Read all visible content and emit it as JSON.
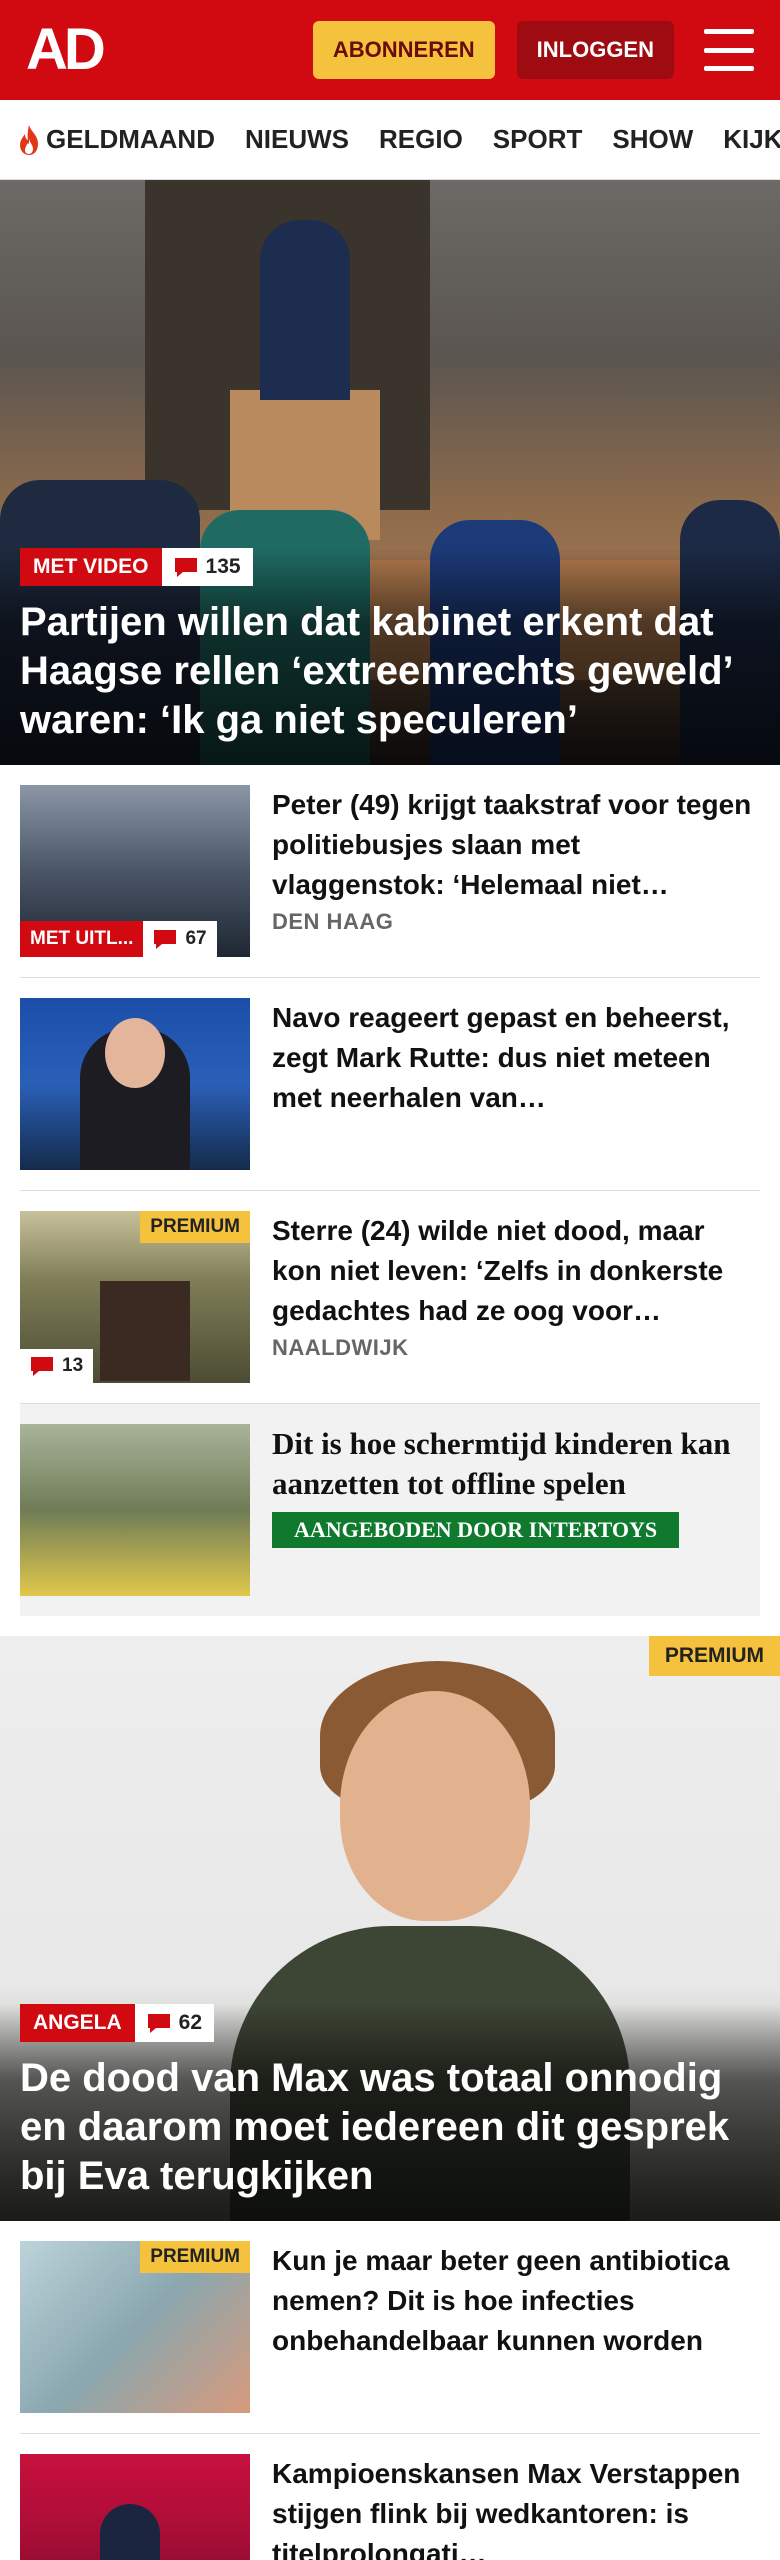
{
  "header": {
    "logo": "AD",
    "subscribe_label": "ABONNEREN",
    "login_label": "INLOGGEN"
  },
  "nav": {
    "items": [
      "GELDMAAND",
      "NIEUWS",
      "REGIO",
      "SPORT",
      "SHOW",
      "KIJK"
    ]
  },
  "hero1": {
    "tag": "MET VIDEO",
    "comments": "135",
    "title": "Partijen willen dat kabinet erkent dat Haagse rellen ‘extreemrechts geweld’ waren: ‘Ik ga niet speculeren’"
  },
  "articles": [
    {
      "title": "Peter (49) krijgt taakstraf voor tegen politiebusjes slaan met vlaggenstok: ‘Helemaal niet…",
      "location": "DEN HAAG",
      "tag": "MET UITL...",
      "comments": "67"
    },
    {
      "title": "Navo reageert gepast en beheerst, zegt Mark Rutte: dus niet meteen met neerhalen van…"
    },
    {
      "title": "Sterre (24) wilde niet dood, maar kon niet leven: ‘Zelfs in donkerste gedachtes had ze oog voor…",
      "location": "NAALDWIJK",
      "premium": "PREMIUM",
      "comments": "13"
    },
    {
      "title": "Dit is hoe schermtijd kinderen kan aanzetten tot offline spelen",
      "sponsor": "AANGEBODEN DOOR INTERTOYS"
    }
  ],
  "hero2": {
    "premium": "PREMIUM",
    "tag": "ANGELA",
    "comments": "62",
    "title": "De dood van Max was totaal onnodig en daarom moet iedereen dit gesprek bij Eva terugkijken"
  },
  "articles2": [
    {
      "title": "Kun je maar beter geen antibioti­ca nemen? Dit is hoe infecties onbehandelbaar kunnen worden",
      "premium": "PREMIUM"
    },
    {
      "title": "Kampioenskansen Max Verstappen stijgen flink bij wedkantoren: is titelprolongati…"
    }
  ],
  "colors": {
    "brand_red": "#d10a11",
    "premium_yellow": "#f5c23d",
    "sponsor_green": "#0f7a2e"
  }
}
